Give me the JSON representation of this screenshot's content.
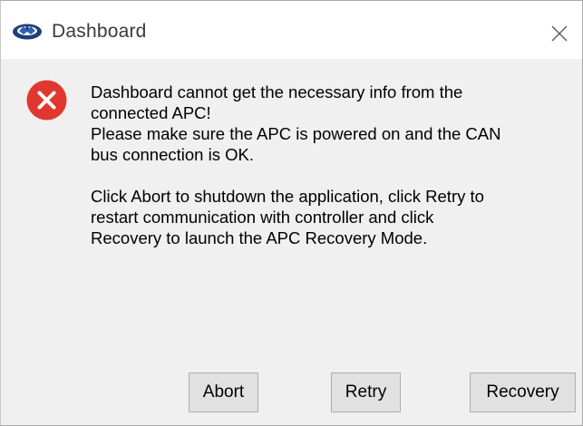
{
  "window": {
    "title": "Dashboard",
    "app_icon": "blue-circle-gauge-icon",
    "close_icon": "close-icon"
  },
  "message": {
    "icon": "error-icon",
    "paragraph1": "Dashboard cannot get the necessary info from the\nconnected APC!\nPlease make sure the APC is powered on and the CAN\nbus connection is OK.",
    "paragraph2": "Click Abort to shutdown the application, click Retry to\nrestart communication with controller and  click\nRecovery to launch the APC Recovery Mode."
  },
  "buttons": {
    "abort": "Abort",
    "retry": "Retry",
    "recovery": "Recovery"
  },
  "colors": {
    "error": "#e0382f",
    "dialog_background": "#f0f0f0",
    "titlebar_background": "#ffffff",
    "button_face": "#e1e1e1"
  }
}
